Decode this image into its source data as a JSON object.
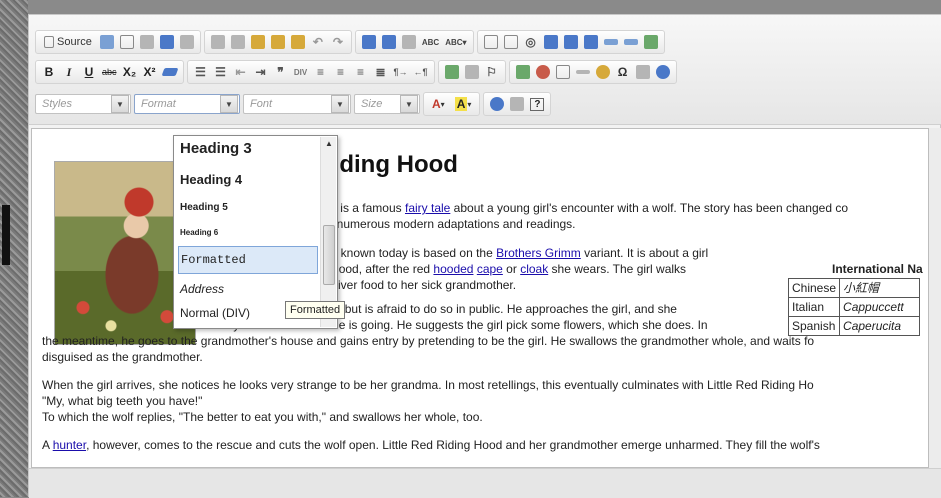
{
  "toolbar": {
    "source_label": "Source",
    "format_styles_placeholder": "Styles",
    "format_placeholder": "Format",
    "font_placeholder": "Font",
    "size_placeholder": "Size",
    "text_color_label": "A",
    "bg_color_label": "A",
    "bold": "B",
    "italic": "I",
    "underline": "U",
    "strike": "abc",
    "subscript": "X₂",
    "superscript": "X²",
    "help": "?"
  },
  "article": {
    "title": "d Riding Hood",
    "lines": [
      {
        "parts": [
          "Hood\" is a famous ",
          "fairy tale",
          " about a young girl's encounter with a wolf. The story has been changed co"
        ]
      },
      {
        "parts": [
          "ect to numerous modern adaptations and readings."
        ]
      },
      {
        "parts": [
          "widely known today is based on the ",
          "Brothers Grimm",
          " variant. It is about a girl"
        ]
      },
      {
        "parts": [
          "ding Hood, after the red ",
          "hooded",
          " ",
          "cape",
          " or ",
          "cloak",
          " she wears. The girl walks"
        ]
      },
      {
        "parts": [
          "deliver food to her sick grandmother."
        ]
      },
      {
        "parts": [
          "A wolf wants to eat the girl but is afraid to do so in public. He approaches the girl, and she"
        ]
      },
      {
        "parts": [
          "naively tells him where she is going. He suggests the girl pick some flowers, which she does. In"
        ]
      },
      {
        "parts": [
          "the meantime, he goes to the grandmother's house and gains entry by pretending to be the girl. He swallows the grandmother whole, and waits fo"
        ]
      },
      {
        "parts": [
          "disguised as the grandmother."
        ]
      },
      {
        "parts": [
          "When the girl arrives, she notices he looks very strange to be her grandma. In most retellings, this eventually culminates with Little Red Riding Ho"
        ]
      },
      {
        "parts": [
          "\"My, what big teeth you have!\""
        ]
      },
      {
        "parts": [
          "To which the wolf replies, \"The better to eat you with,\" and swallows her whole, too."
        ]
      },
      {
        "parts": [
          "A ",
          "hunter",
          ", however, comes to the rescue and cuts the wolf open. Little Red Riding Hood and her grandmother emerge unharmed. They fill the wolf's"
        ]
      }
    ]
  },
  "names_table": {
    "caption": "International Na",
    "rows": [
      {
        "lang": "Chinese",
        "name": "小紅帽"
      },
      {
        "lang": "Italian",
        "name": "Cappuccett"
      },
      {
        "lang": "Spanish",
        "name": "Caperucita"
      }
    ]
  },
  "format_dropdown": {
    "items": [
      "Heading 3",
      "Heading 4",
      "Heading 5",
      "Heading 6",
      "Formatted",
      "Address",
      "Normal (DIV)"
    ],
    "selected": "Formatted",
    "tooltip": "Formatted"
  }
}
